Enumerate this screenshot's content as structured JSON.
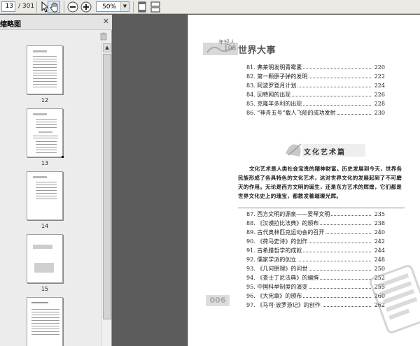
{
  "toolbar": {
    "page_current": "13",
    "page_total": "/ 301",
    "zoom": "50%",
    "icons": [
      "select-arrow-icon",
      "hand-tool-icon",
      "zoom-out-icon",
      "zoom-in-icon",
      "zoom-dropdown-icon",
      "fit-page-icon",
      "two-page-icon"
    ]
  },
  "sidebar": {
    "title": "缩略图",
    "close": "✕",
    "thumbnails": [
      {
        "label": "12"
      },
      {
        "label": "13",
        "current": true
      },
      {
        "label": "14"
      },
      {
        "label": "15"
      },
      {
        "label": ""
      }
    ]
  },
  "page": {
    "header": {
      "small": "年轻人",
      "mid": "108",
      "title": "世界大事"
    },
    "toc_part1": [
      {
        "title": "81. 弗莱明发明青霉素",
        "page": "220"
      },
      {
        "title": "82. 第一颗原子弹的发明",
        "page": "222"
      },
      {
        "title": "83. 阿波罗登月计划",
        "page": "224"
      },
      {
        "title": "84. 因特网的出现",
        "page": "226"
      },
      {
        "title": "85. 克隆羊多利的出现",
        "page": "228"
      },
      {
        "title": "86. “神舟五号”载人飞船的成功发射",
        "page": "230"
      }
    ],
    "section_title": "文化艺术篇",
    "intro": "文化艺术是人类社会宝贵的精神财富。历史发展到今天，世界各民族形成了各具特色的文化艺术，这对世界文化的发展起到了不可磨灭的作用。无论是西方文明的诞生，还是东方艺术的辉煌，它们都是世界文化史上的瑰宝，都教发着璀璨光辉。",
    "toc_part2": [
      {
        "title": "87.  西方文明的源泉——爱琴文明",
        "page": "235"
      },
      {
        "title": "88. 《汉谟拉比法典》的颁布",
        "page": "238"
      },
      {
        "title": "89.  古代奥林匹克运动会的召开",
        "page": "240"
      },
      {
        "title": "90. 《荷马史诗》的创作",
        "page": "242"
      },
      {
        "title": "91.  古希腊哲学的成就",
        "page": "244"
      },
      {
        "title": "92.  儒家学派的创立",
        "page": "248"
      },
      {
        "title": "93. 《几何原理》的问世",
        "page": "250"
      },
      {
        "title": "94. 《查士丁尼法典》的编撰",
        "page": "252"
      },
      {
        "title": "95.  中国科举制度的演变",
        "page": "255"
      },
      {
        "title": "96. 《大宪章》的颁布",
        "page": "260"
      },
      {
        "title": "97. 《马可·波罗游记》的创作",
        "page": "262"
      }
    ],
    "page_number": "006"
  }
}
